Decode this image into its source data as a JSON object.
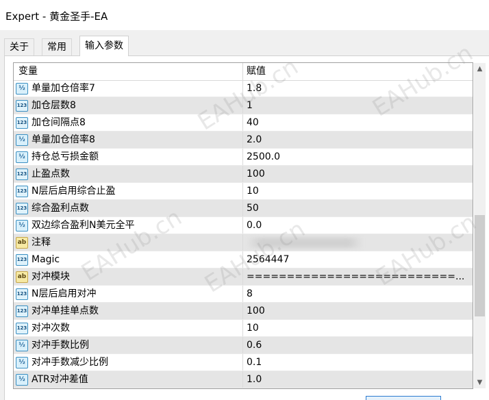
{
  "window": {
    "title": "Expert - 黄金圣手-EA"
  },
  "tabs": [
    {
      "label": "关于"
    },
    {
      "label": "常用"
    },
    {
      "label": "输入参数"
    }
  ],
  "table": {
    "headers": {
      "variable": "变量",
      "value": "赋值"
    },
    "rows": [
      {
        "type_icon": "double-icon",
        "icon_text": "½",
        "name": "单量加仓倍率7",
        "value": "1.8"
      },
      {
        "type_icon": "int-icon",
        "icon_text": "123",
        "name": "加仓层数8",
        "value": "1"
      },
      {
        "type_icon": "int-icon",
        "icon_text": "123",
        "name": "加仓间隔点8",
        "value": "40"
      },
      {
        "type_icon": "double-icon",
        "icon_text": "½",
        "name": "单量加仓倍率8",
        "value": "2.0"
      },
      {
        "type_icon": "double-icon",
        "icon_text": "½",
        "name": "持仓总亏损金额",
        "value": "2500.0"
      },
      {
        "type_icon": "int-icon",
        "icon_text": "123",
        "name": "止盈点数",
        "value": "100"
      },
      {
        "type_icon": "int-icon",
        "icon_text": "123",
        "name": "N层后启用综合止盈",
        "value": "10"
      },
      {
        "type_icon": "int-icon",
        "icon_text": "123",
        "name": "综合盈利点数",
        "value": "50"
      },
      {
        "type_icon": "double-icon",
        "icon_text": "½",
        "name": "双边综合盈利N美元全平",
        "value": "0.0"
      },
      {
        "type_icon": "string-icon",
        "icon_text": "ab",
        "name": "注释",
        "value": ""
      },
      {
        "type_icon": "int-icon",
        "icon_text": "123",
        "name": "Magic",
        "value": "2564447"
      },
      {
        "type_icon": "string-icon",
        "icon_text": "ab",
        "name": "对冲模块",
        "value": "==========================..."
      },
      {
        "type_icon": "int-icon",
        "icon_text": "123",
        "name": "N层后启用对冲",
        "value": "8"
      },
      {
        "type_icon": "int-icon",
        "icon_text": "123",
        "name": "对冲单挂单点数",
        "value": "100"
      },
      {
        "type_icon": "int-icon",
        "icon_text": "123",
        "name": "对冲次数",
        "value": "10"
      },
      {
        "type_icon": "double-icon",
        "icon_text": "½",
        "name": "对冲手数比例",
        "value": "0.6"
      },
      {
        "type_icon": "double-icon",
        "icon_text": "½",
        "name": "对冲手数减少比例",
        "value": "0.1"
      },
      {
        "type_icon": "double-icon",
        "icon_text": "½",
        "name": "ATR对冲差值",
        "value": "1.0"
      }
    ]
  },
  "watermark": {
    "text": "EAHub.cn"
  },
  "scrollbar": {
    "up_icon": "chevron-up-icon",
    "down_icon": "chevron-down-icon"
  }
}
